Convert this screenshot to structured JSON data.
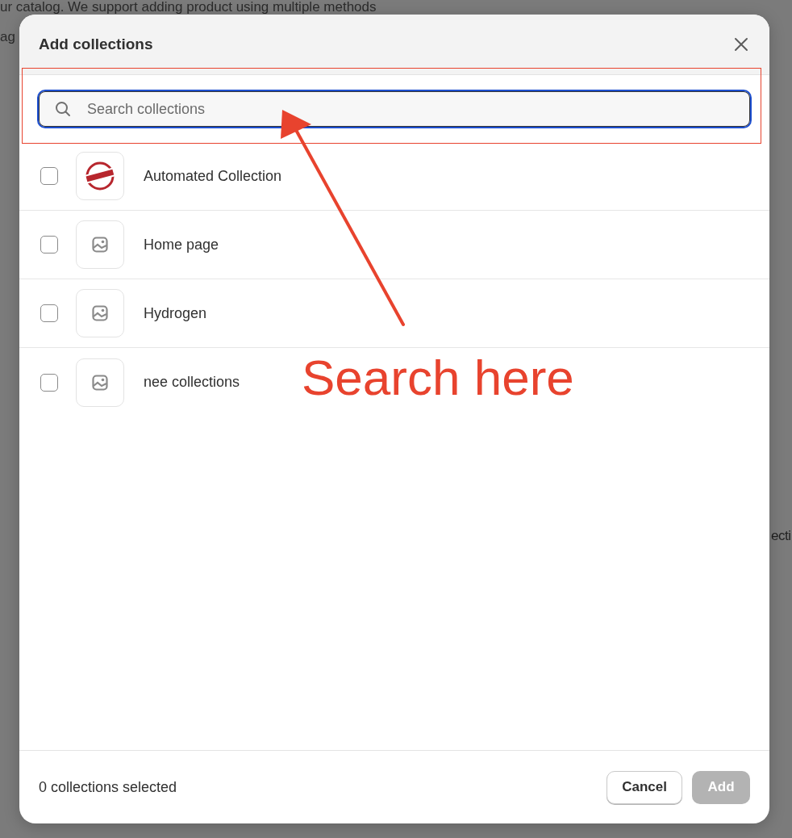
{
  "background_page": {
    "lines": [
      "ur catalog. We support adding product using multiple methods",
      "ag"
    ],
    "side_text": "ecti"
  },
  "dialog": {
    "title": "Add collections",
    "search": {
      "placeholder": "Search collections",
      "focused": true
    },
    "items": [
      {
        "name": "Automated Collection",
        "checked": false,
        "kind": "picture"
      },
      {
        "name": "Home page",
        "checked": false,
        "kind": "placeholder"
      },
      {
        "name": "Hydrogen",
        "checked": false,
        "kind": "placeholder"
      },
      {
        "name": "nee collections",
        "checked": false,
        "kind": "placeholder"
      }
    ],
    "footer": {
      "selection_count": "0 collections selected",
      "buttons": [
        {
          "label": "Cancel",
          "kind": "secondary",
          "disabled": false
        },
        {
          "label": "Add",
          "kind": "primary",
          "disabled": true
        }
      ]
    }
  },
  "annotation": {
    "label": "Search here"
  }
}
